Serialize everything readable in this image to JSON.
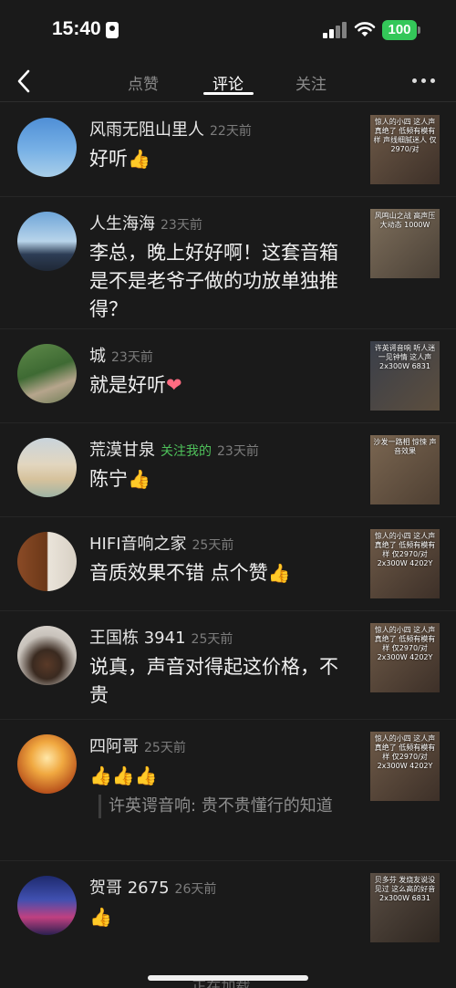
{
  "status": {
    "time": "15:40",
    "battery": "100"
  },
  "nav": {
    "tabs": [
      "点赞",
      "评论",
      "关注"
    ],
    "active_tab": 1
  },
  "comments": [
    {
      "name": "风雨无阻山里人",
      "ago": "22天前",
      "text": "好听",
      "emoji": "thumbs-up",
      "thumb_text": "惊人的小四 这人声真绝了 低频有模有样 声线细腻迷人 仅2970/对"
    },
    {
      "name": "人生海海",
      "ago": "23天前",
      "text": "李总，晚上好好啊！这套音箱是不是老爷子做的功放单独推得？",
      "thumb_text": "风鸣山之战 高声压 大动态 1000W"
    },
    {
      "name": "城",
      "ago": "23天前",
      "text": "就是好听",
      "emoji": "heart",
      "thumb_text": "许英谔音响 听人迷 一见钟情 这人声 2x300W 6831"
    },
    {
      "name": "荒漠甘泉",
      "follow_tag": "关注我的",
      "ago": "23天前",
      "text": "陈宁",
      "emoji": "thumbs-up",
      "thumb_text": "沙发一路相 惊悚 声音效果"
    },
    {
      "name": "HIFI音响之家",
      "ago": "25天前",
      "text": "音质效果不错 点个赞",
      "emoji": "thumbs-up",
      "thumb_text": "惊人的小四 这人声真绝了 低频有模有样 仅2970/对 2x300W 4202Y"
    },
    {
      "name": "王国栋 3941",
      "ago": "25天前",
      "text": "说真，声音对得起这价格，不贵",
      "thumb_text": "惊人的小四 这人声真绝了 低频有模有样 仅2970/对 2x300W 4202Y"
    },
    {
      "name": "四阿哥",
      "ago": "25天前",
      "text": "",
      "emoji_count": 3,
      "reply": "许英谔音响: 贵不贵懂行的知道",
      "thumb_text": "惊人的小四 这人声真绝了 低频有模有样 仅2970/对 2x300W 4202Y"
    },
    {
      "name": "贺哥 2675",
      "ago": "26天前",
      "text": "",
      "emoji": "thumbs-up",
      "thumb_text": "贝多芬 发烧友说没见过 这么高的好音 2x300W 6831"
    }
  ],
  "footer": {
    "loading": "正在加载..."
  },
  "colors": {
    "accent_green": "#4ec15a",
    "battery": "#34c759",
    "background": "#1a1a1a"
  }
}
